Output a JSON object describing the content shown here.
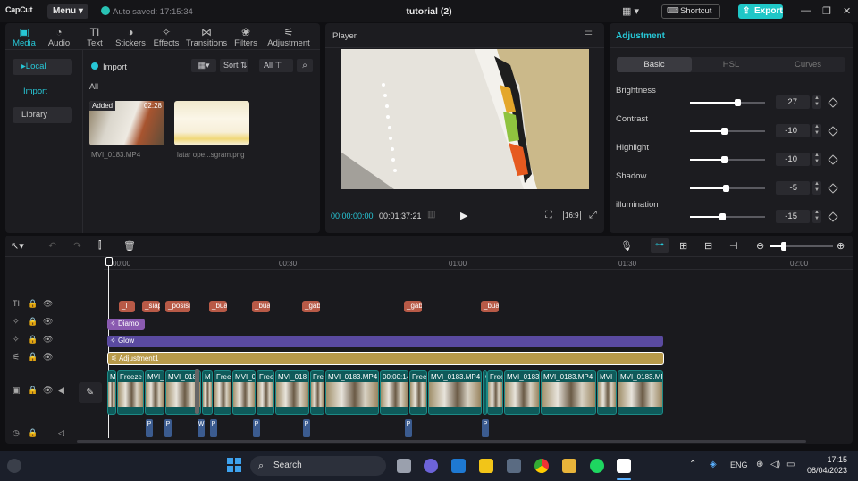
{
  "titlebar": {
    "logo": "CapCut",
    "menu_label": "Menu",
    "saved_text": "Auto saved: 17:15:34",
    "project_title": "tutorial (2)",
    "shortcut_label": "Shortcut",
    "export_label": "Export"
  },
  "media": {
    "tabs": [
      {
        "label": "Media",
        "icon": "media-icon"
      },
      {
        "label": "Audio",
        "icon": "audio-icon"
      },
      {
        "label": "Text",
        "icon": "text-icon"
      },
      {
        "label": "Stickers",
        "icon": "stickers-icon"
      },
      {
        "label": "Effects",
        "icon": "effects-icon"
      },
      {
        "label": "Transitions",
        "icon": "transitions-icon"
      },
      {
        "label": "Filters",
        "icon": "filters-icon"
      },
      {
        "label": "Adjustment",
        "icon": "adjustment-icon"
      }
    ],
    "sidebar": {
      "local": "Local",
      "import": "Import",
      "library": "Library"
    },
    "import_label": "Import",
    "sort_label": "Sort",
    "all_filter": "All",
    "section_label": "All",
    "items": [
      {
        "name": "MVI_0183.MP4",
        "badge": "Added",
        "duration": "02:28"
      },
      {
        "name": "latar ope...sgram.png"
      }
    ]
  },
  "player": {
    "title": "Player",
    "current_time": "00:00:00:00",
    "total_time": "00:01:37:21",
    "ratio": "16:9"
  },
  "adjustment": {
    "title": "Adjustment",
    "tabs": [
      "Basic",
      "HSL",
      "Curves"
    ],
    "params": [
      {
        "label": "Brightness",
        "value": "27",
        "fraction": 0.627
      },
      {
        "label": "Contrast",
        "value": "-10",
        "fraction": 0.45
      },
      {
        "label": "Highlight",
        "value": "-10",
        "fraction": 0.45
      },
      {
        "label": "Shadow",
        "value": "-5",
        "fraction": 0.475
      },
      {
        "label": "illumination",
        "value": "-15",
        "fraction": 0.425
      }
    ]
  },
  "timeline": {
    "ruler": [
      "00:00",
      "00:30",
      "01:00",
      "01:30",
      "02:00"
    ],
    "text_clips": [
      "_l",
      "_siap",
      "_posisi",
      "_bua",
      "_bua",
      "_gab",
      "_gab",
      "_bua"
    ],
    "effect_clips": {
      "diamond": "Diamo",
      "glow": "Glow"
    },
    "adjustment_clip": "Adjustment1",
    "video_clips": [
      "M",
      "Freeze",
      "MVI_",
      "MVI_018",
      "M",
      "Free",
      "MVI_0",
      "Free",
      "MVI_018",
      "Free",
      "MVI_0183.MP4",
      "00:00:14",
      "Free",
      "MVI_0183.MP4",
      "C",
      "Free",
      "MVI_0183",
      "MVI_0183.MP4",
      "MVI",
      "MVI_0183.MP4"
    ],
    "audio_markers": [
      "P",
      "P",
      "W",
      "P",
      "P",
      "P",
      "P",
      "P"
    ]
  },
  "taskbar": {
    "search_label": "Search",
    "language": "ENG",
    "time": "17:15",
    "date": "08/04/2023"
  },
  "colors": {
    "accent": "#1fc7c7",
    "text_clip": "#b85a47",
    "effect_clip": "#5a4aa0",
    "adjust_clip": "#b89a4a",
    "video_clip": "#0f5a5a"
  }
}
